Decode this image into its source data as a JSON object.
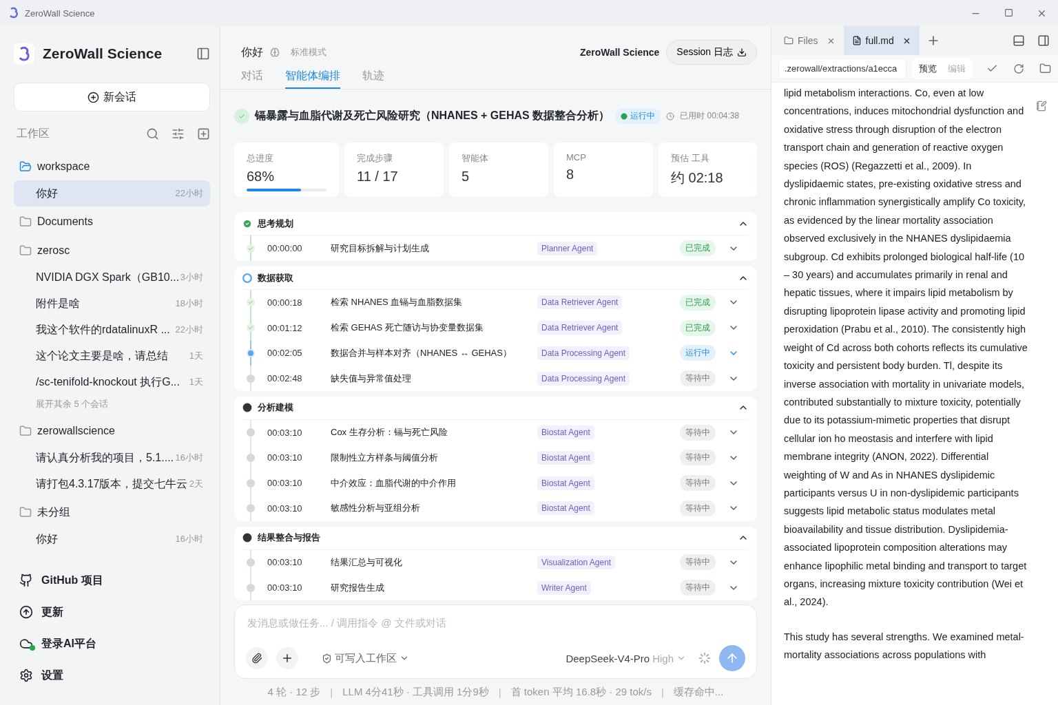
{
  "window": {
    "title": "ZeroWall Science"
  },
  "sidebar": {
    "brand": "ZeroWall Science",
    "new_chat": "新会话",
    "workspace_label": "工作区",
    "groups": [
      {
        "name": "workspace",
        "active": true,
        "items": [
          {
            "title": "你好",
            "time": "22小时",
            "selected": true
          }
        ]
      },
      {
        "name": "Documents",
        "active": false
      },
      {
        "name": "zerosc",
        "active": false,
        "items": [
          {
            "title": "NVIDIA DGX Spark（GB10...",
            "time": "3小时",
            "selected": false
          },
          {
            "title": "附件是啥",
            "time": "18小时",
            "selected": false
          },
          {
            "title": "我这个软件的rdatalinuxR ...",
            "time": "22小时",
            "selected": false
          },
          {
            "title": "这个论文主要是啥，请总结",
            "time": "1天",
            "selected": false
          },
          {
            "title": "/sc-tenifold-knockout 执行G...",
            "time": "1天",
            "selected": false
          }
        ],
        "more": "展开其余 5 个会话"
      },
      {
        "name": "zerowallscience",
        "active": false,
        "items": [
          {
            "title": "请认真分析我的项目，5.1....",
            "time": "16小时",
            "selected": false
          },
          {
            "title": "请打包4.3.17版本，提交七牛云",
            "time": "2天",
            "selected": false
          }
        ]
      },
      {
        "name": "未分组",
        "active": false,
        "items": [
          {
            "title": "你好",
            "time": "16小时",
            "selected": false
          }
        ]
      }
    ],
    "nav": [
      {
        "kind": "github",
        "label": "GitHub 项目"
      },
      {
        "kind": "update",
        "label": "更新"
      },
      {
        "kind": "login",
        "label": "登录AI平台",
        "online": true
      },
      {
        "kind": "settings",
        "label": "设置"
      }
    ]
  },
  "header": {
    "title": "你好",
    "mode": "标准模式",
    "brand": "ZeroWall Science",
    "session_button": "Session 日志",
    "tabs": [
      {
        "label": "对话",
        "selected": false
      },
      {
        "label": "智能体编排",
        "selected": true
      },
      {
        "label": "轨迹",
        "selected": false
      }
    ]
  },
  "task": {
    "title": "镉暴露与血脂代谢及死亡风险研究（NHANES + GEHAS 数据整合分析）",
    "status": "运行中",
    "elapsed": "已用时 00:04:38"
  },
  "stats": [
    {
      "label": "总进度",
      "value": "68%",
      "level": 0.68
    },
    {
      "label": "完成步骤",
      "value": "11 / 17"
    },
    {
      "label": "智能体",
      "value": "5"
    },
    {
      "label": "MCP",
      "value": "8"
    },
    {
      "label": "预估 工具",
      "value": "约 02:18"
    }
  ],
  "sections": [
    {
      "title": "思考规划",
      "kind": "done",
      "expanded": true,
      "steps": [
        {
          "time": "00:00:00",
          "title": "研究目标拆解与计划生成",
          "agent": "Planner Agent",
          "status": "已完成",
          "kind": "done"
        }
      ]
    },
    {
      "title": "数据获取",
      "kind": "running",
      "expanded": true,
      "steps": [
        {
          "time": "00:00:18",
          "title": "检索 NHANES 血镉与血脂数据集",
          "agent": "Data Retriever Agent",
          "status": "已完成",
          "kind": "done"
        },
        {
          "time": "00:01:12",
          "title": "检索 GEHAS 死亡随访与协变量数据集",
          "agent": "Data Retriever Agent",
          "status": "已完成",
          "kind": "done"
        },
        {
          "time": "00:02:05",
          "title": "数据合并与样本对齐（NHANES ↔ GEHAS）",
          "agent": "Data Processing Agent",
          "status": "运行中",
          "kind": "running"
        },
        {
          "time": "00:02:48",
          "title": "缺失值与异常值处理",
          "agent": "Data Processing Agent",
          "status": "等待中",
          "kind": "waiting"
        }
      ]
    },
    {
      "title": "分析建模",
      "kind": "waiting",
      "expanded": true,
      "steps": [
        {
          "time": "00:03:10",
          "title": "Cox 生存分析：镉与死亡风险",
          "agent": "Biostat Agent",
          "status": "等待中",
          "kind": "waiting"
        },
        {
          "time": "00:03:10",
          "title": "限制性立方样条与阈值分析",
          "agent": "Biostat Agent",
          "status": "等待中",
          "kind": "waiting"
        },
        {
          "time": "00:03:10",
          "title": "中介效应：血脂代谢的中介作用",
          "agent": "Biostat Agent",
          "status": "等待中",
          "kind": "waiting"
        },
        {
          "time": "00:03:10",
          "title": "敏感性分析与亚组分析",
          "agent": "Biostat Agent",
          "status": "等待中",
          "kind": "waiting"
        }
      ]
    },
    {
      "title": "结果整合与报告",
      "kind": "waiting",
      "expanded": true,
      "steps": [
        {
          "time": "00:03:10",
          "title": "结果汇总与可视化",
          "agent": "Visualization Agent",
          "status": "等待中",
          "kind": "waiting"
        },
        {
          "time": "00:03:10",
          "title": "研究报告生成",
          "agent": "Writer Agent",
          "status": "等待中",
          "kind": "waiting"
        }
      ]
    }
  ],
  "composer": {
    "placeholder": "发消息或做任务... / 调用指令 @ 文件或对话",
    "permission": "可写入工作区",
    "model": "DeepSeek-V4-Pro",
    "effort": "High"
  },
  "footer": {
    "separator": "|",
    "items": [
      "4 轮 · 12 步",
      "LLM 4分41秒 · 工具调用 1分9秒",
      "首 token 平均 16.8秒 · 29 tok/s",
      "缓存命中..."
    ]
  },
  "panel": {
    "tabs": [
      {
        "label": "Files",
        "kind": "folder",
        "selected": false
      },
      {
        "label": "full.md",
        "kind": "markdown",
        "selected": true
      }
    ],
    "path": ".zerowall/extractions/a1ecca",
    "modes": [
      {
        "label": "预览",
        "selected": true
      },
      {
        "label": "编辑",
        "selected": false
      }
    ],
    "paragraphs": [
      "lipid metabolism interactions. Co, even at low concentrations, induces mitochondrial dysfunction and oxidative stress through disruption of the electron transport chain and generation of reactive oxygen species (ROS) (Regazzetti et al., 2009). In dyslipidaemic states, pre-existing oxidative stress and chronic inflammation synergistically amplify Co toxicity, as evidenced by the linear mortality association observed exclusively in the NHANES dyslipidaemia subgroup. Cd exhibits prolonged biological half-life (10 – 30 years) and accumulates primarily in renal and hepatic tissues, where it impairs lipid metabolism by disrupting lipoprotein lipase activity and promoting lipid peroxidation (Prabu et al., 2010). The consistently high weight of Cd across both cohorts reflects its cumulative toxicity and persistent body burden. Tl, despite its inverse association with mortality in univariate models, contributed substantially to mixture toxicity, potentially due to its potassium-mimetic properties that disrupt cellular ion ho meostasis and interfere with lipid membrane integrity (ANON, 2022). Differential weighting of W and As in NHANES dyslipidemic participants versus U in non-dyslipidemic participants suggests lipid metabolic status modulates metal bioavailability and tissue distribution. Dyslipidemia-associated lipoprotein composition alterations may enhance lipophilic metal binding and transport to target organs, increasing mixture toxicity contribution (Wei et al., 2024).",
      "This study has several strengths. We examined metal-mortality associations across populations with"
    ]
  }
}
